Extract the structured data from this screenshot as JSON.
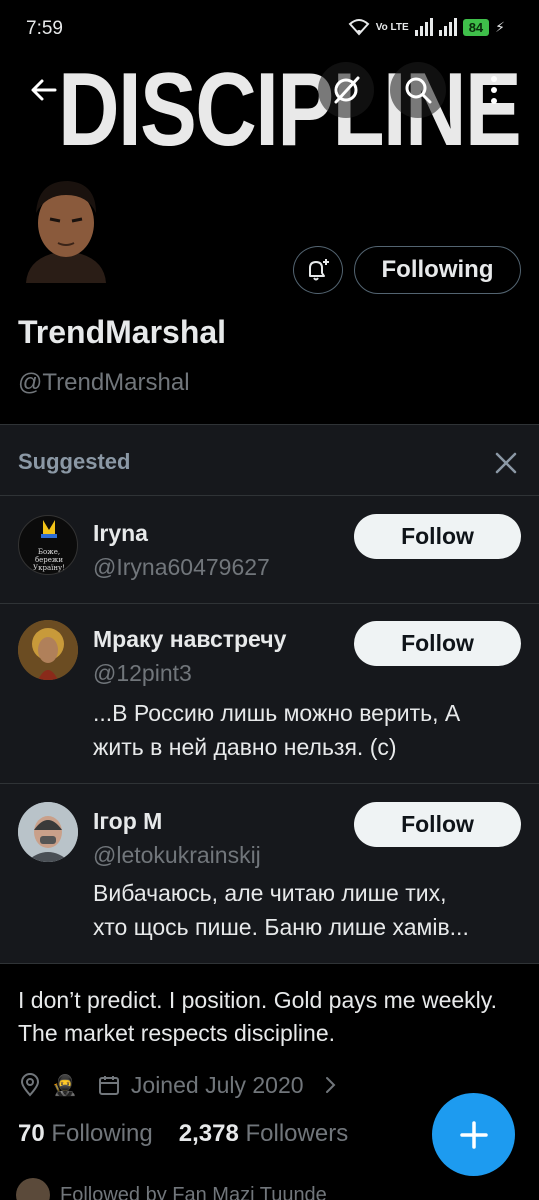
{
  "status_bar": {
    "time": "7:59",
    "network": "Vo LTE",
    "battery": "84"
  },
  "banner": {
    "text": "DISCIPLINE"
  },
  "header": {
    "back_icon": "arrow-left-icon",
    "grok_icon": "slashed-circle-icon",
    "search_icon": "search-icon",
    "more_icon": "more-vertical-icon"
  },
  "profile": {
    "display_name": "TrendMarshal",
    "handle": "@TrendMarshal",
    "following_label": "Following",
    "bio": "I don’t predict. I position.  Gold pays me weekly. The market respects discipline.",
    "joined": "Joined July 2020",
    "following_count": "70",
    "following_label_text": "Following",
    "followers_count": "2,378",
    "followers_label_text": "Followers",
    "followed_by": "Followed by Fan Mazi Tuunde"
  },
  "suggested": {
    "title": "Suggested",
    "items": [
      {
        "name": "Iryna",
        "handle": "@Iryna60479627",
        "bio": "",
        "follow_label": "Follow"
      },
      {
        "name": "Мраку навстречу",
        "handle": "@12pint3",
        "bio_line1": "...В Россию лишь можно верить, А",
        "bio_line2": "жить в ней давно нельзя. (с)",
        "follow_label": "Follow"
      },
      {
        "name": "Ігор М",
        "handle": "@letokukrainskij",
        "bio_line1": "Вибачаюсь, але читаю лише тих,",
        "bio_line2": "хто щось пише. Баню лише хамів...",
        "follow_label": "Follow"
      }
    ]
  },
  "colors": {
    "accent": "#1d9bf0",
    "background": "#000000",
    "panel": "#16181c",
    "muted_text": "#71767b"
  }
}
